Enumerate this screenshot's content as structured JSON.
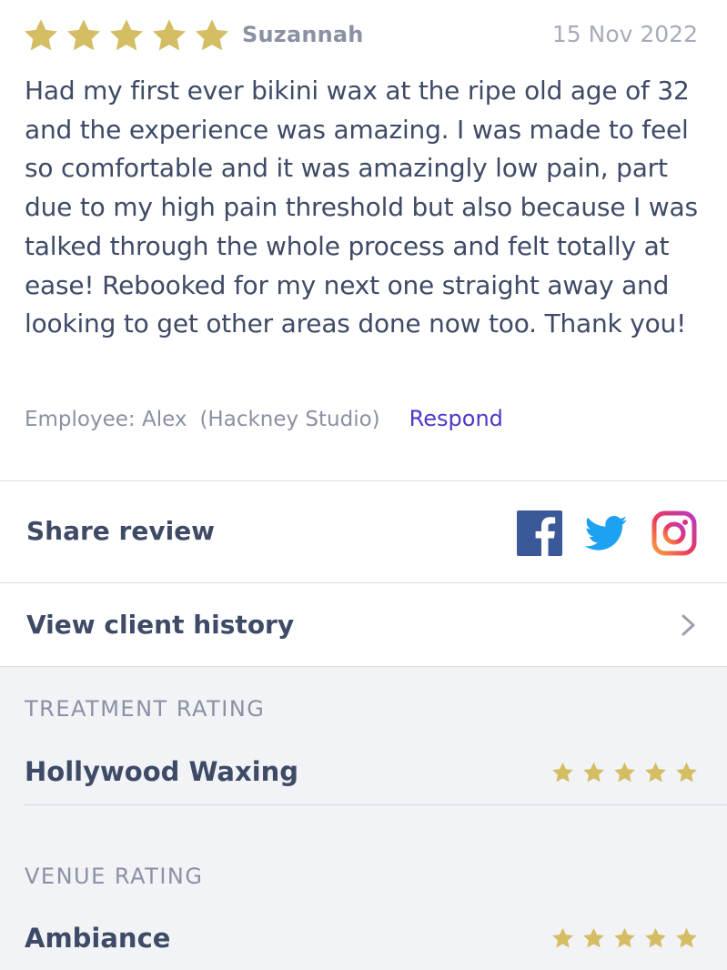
{
  "review": {
    "rating": 5,
    "reviewer": "Suzannah",
    "date": "15 Nov 2022",
    "body": "Had my first ever bikini wax at the ripe old age of 32 and the experience was amazing. I was made to feel so comfortable and it was amazingly low pain, part due to my high pain threshold but also because I was talked through the whole process and felt totally at ease! Rebooked for my next one straight away and looking to get other areas done now too. Thank you!",
    "employee": "Employee: Alex",
    "studio": "(Hackney Studio)",
    "respond_label": "Respond"
  },
  "share": {
    "label": "Share review",
    "icons": [
      "facebook-icon",
      "twitter-icon",
      "instagram-icon"
    ]
  },
  "history": {
    "label": "View client history",
    "icon": "chevron-right-icon"
  },
  "treatment": {
    "heading": "TREATMENT RATING",
    "item": "Hollywood Waxing",
    "rating": 5
  },
  "venue": {
    "heading": "VENUE RATING",
    "item": "Ambiance",
    "rating": 5
  },
  "colors": {
    "star": "#d4bd63",
    "accent": "#5236c8",
    "facebook": "#3b5998",
    "twitter": "#1da1f2"
  }
}
